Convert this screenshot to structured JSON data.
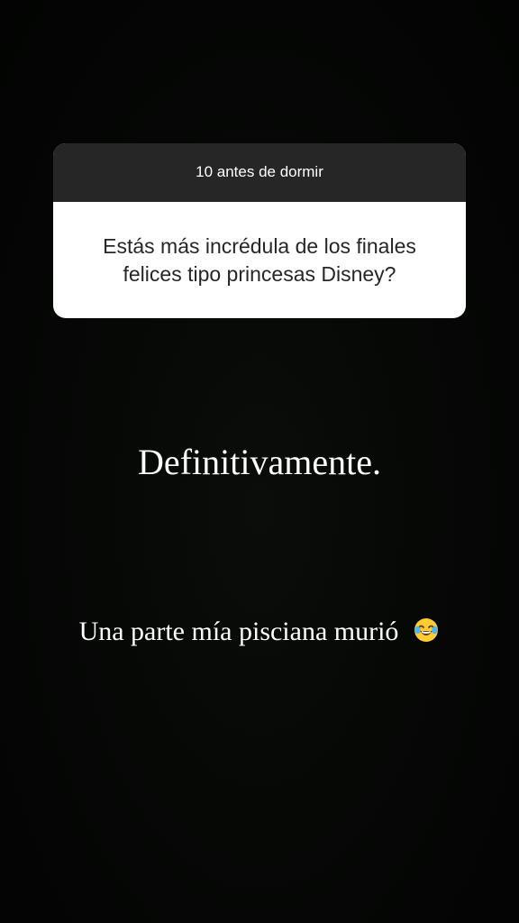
{
  "question_sticker": {
    "header": "10 antes de dormir",
    "question": "Estás más incrédula de los finales felices tipo princesas Disney?"
  },
  "answer": {
    "main_text": "Definitivamente.",
    "sub_text": "Una parte mía pisciana murió",
    "emoji": "face-with-tears-of-joy-icon"
  },
  "colors": {
    "background": "#050605",
    "card_header": "#262626",
    "card_body": "#ffffff",
    "text_light": "#ffffff",
    "text_dark": "#262626"
  }
}
